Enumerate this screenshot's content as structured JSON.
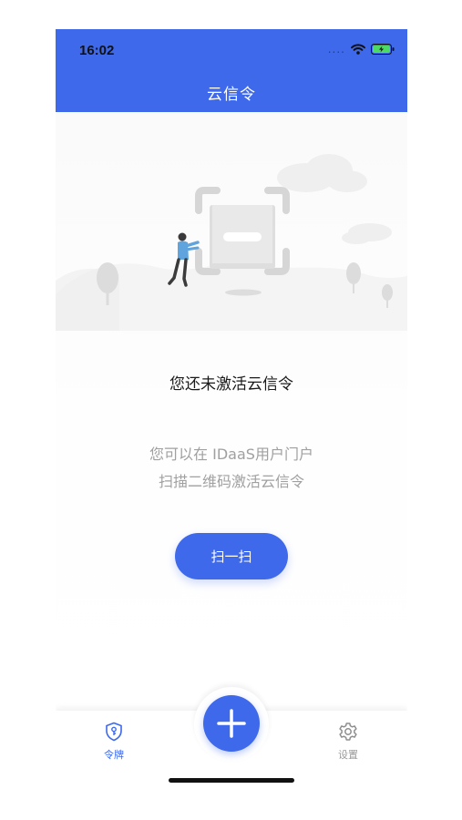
{
  "status_bar": {
    "time": "16:02",
    "signal": "....",
    "wifi_icon": "wifi-icon",
    "battery_icon": "battery-charging-icon"
  },
  "header": {
    "title": "云信令"
  },
  "empty_state": {
    "illustration_icon": "scan-frame-illustration",
    "title": "您还未激活云信令",
    "description_line1": "您可以在 IDaaS用户门户",
    "description_line2": "扫描二维码激活云信令",
    "scan_button_label": "扫一扫"
  },
  "tab_bar": {
    "tabs": [
      {
        "label": "令牌",
        "icon": "shield-key-icon",
        "active": true
      },
      {
        "label": "设置",
        "icon": "gear-icon",
        "active": false
      }
    ],
    "add_button_icon": "plus-icon"
  },
  "colors": {
    "accent": "#3e69ea",
    "inactive": "#9a9a9a",
    "desc_text": "#a0a0a0"
  }
}
